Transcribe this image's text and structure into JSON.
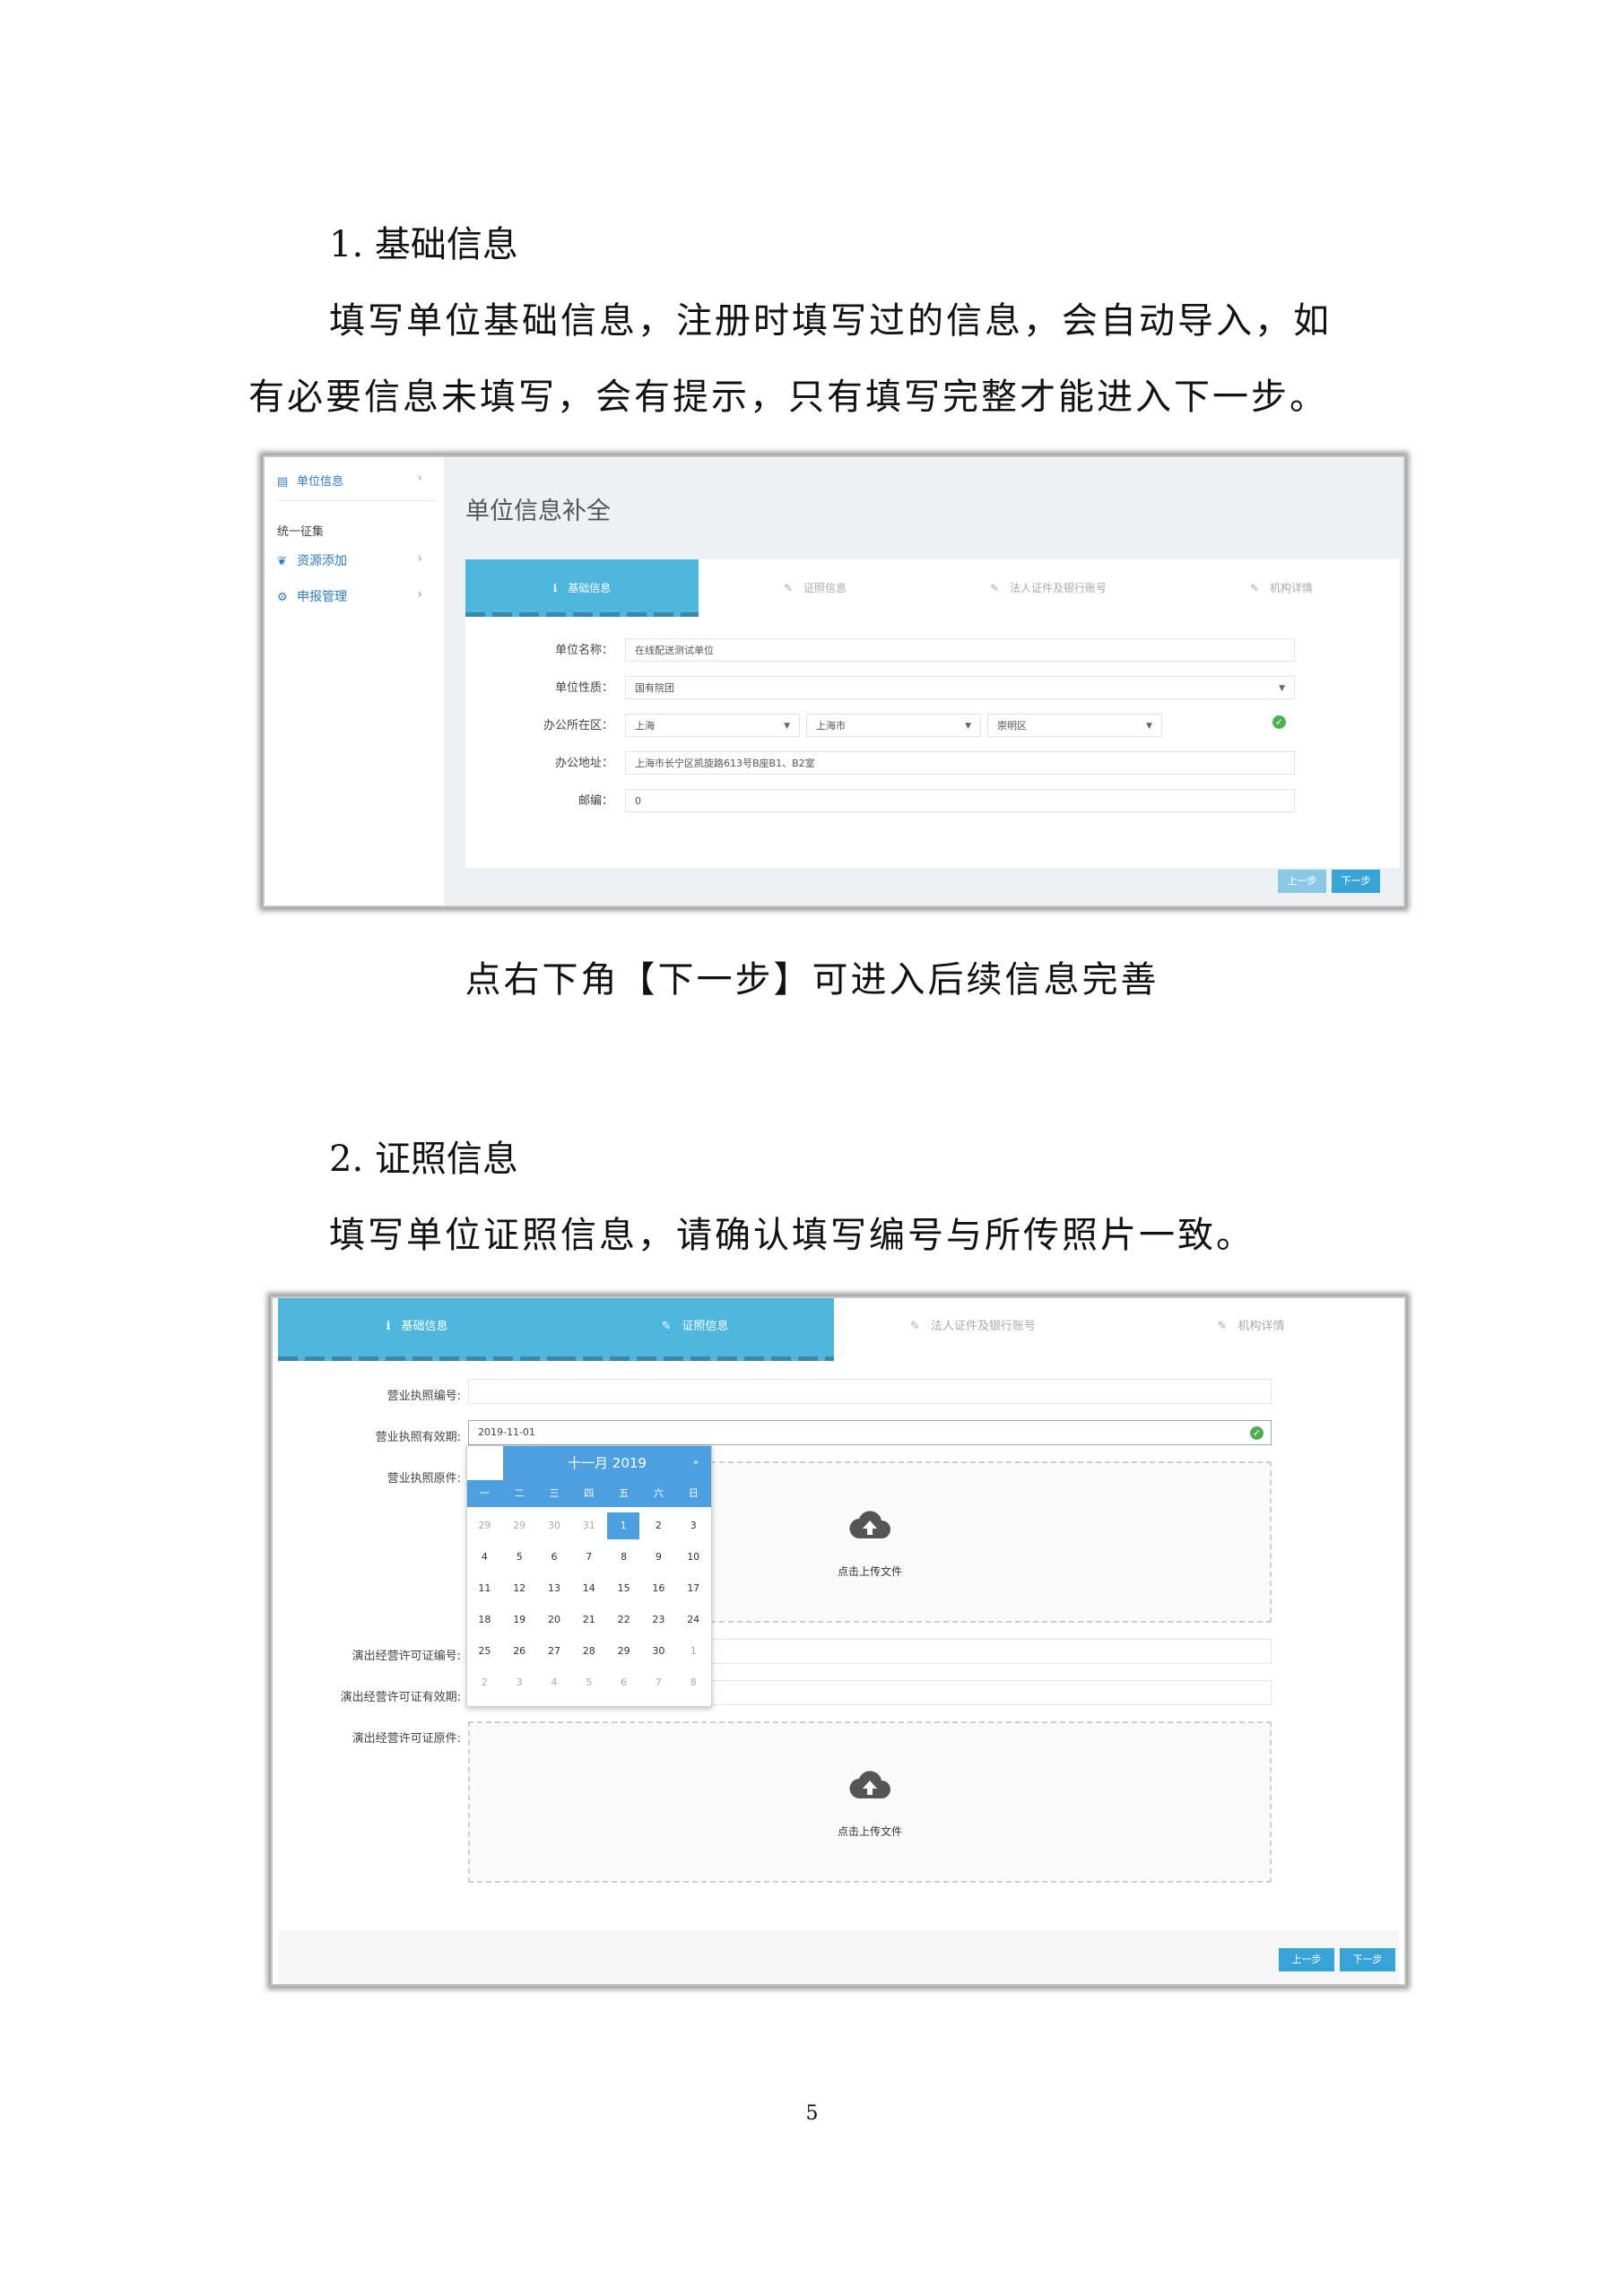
{
  "doc": {
    "section1_title": "1. 基础信息",
    "section1_para_line1": "填写单位基础信息，注册时填写过的信息，会自动导入，如",
    "section1_para_line2": "有必要信息未填写，会有提示，只有填写完整才能进入下一步。",
    "section1_caption": "点右下角【下一步】可进入后续信息完善",
    "section2_title": "2. 证照信息",
    "section2_para": "填写单位证照信息，请确认填写编号与所传照片一致。",
    "page_number": "5"
  },
  "shot1": {
    "sidebar": {
      "top_item": "单位信息",
      "group_title": "统一征集",
      "items": [
        {
          "label": "资源添加"
        },
        {
          "label": "申报管理"
        }
      ]
    },
    "page_title": "单位信息补全",
    "tabs": [
      {
        "label": "基础信息",
        "icon": "info-icon"
      },
      {
        "label": "证照信息",
        "icon": "edit-icon"
      },
      {
        "label": "法人证件及银行账号",
        "icon": "edit-icon"
      },
      {
        "label": "机构详情",
        "icon": "edit-icon"
      }
    ],
    "form": {
      "name_label": "单位名称：",
      "name_value": "在线配送测试单位",
      "type_label": "单位性质：",
      "type_value": "国有院团",
      "region_label": "办公所在区：",
      "province": "上海",
      "city": "上海市",
      "district": "崇明区",
      "address_label": "办公地址：",
      "address_value": "上海市长宁区凯旋路613号B座B1、B2室",
      "postcode_label": "邮编：",
      "postcode_value": "0"
    },
    "buttons": {
      "prev": "上一步",
      "next": "下一步"
    }
  },
  "shot2": {
    "tabs": [
      {
        "label": "基础信息",
        "icon": "info-icon"
      },
      {
        "label": "证照信息",
        "icon": "edit-icon"
      },
      {
        "label": "法人证件及银行账号",
        "icon": "edit-icon"
      },
      {
        "label": "机构详情",
        "icon": "edit-icon"
      }
    ],
    "form": {
      "license_no_label": "营业执照编号:",
      "license_expiry_label": "营业执照有效期:",
      "license_expiry_value": "2019-11-01",
      "license_file_label": "营业执照原件:",
      "perf_no_label": "演出经营许可证编号:",
      "perf_expiry_label": "演出经营许可证有效期:",
      "perf_file_label": "演出经营许可证原件:",
      "upload_text": "点击上传文件"
    },
    "calendar": {
      "title": "十一月 2019",
      "next_arrow": "»",
      "weekdays": [
        "一",
        "二",
        "三",
        "四",
        "五",
        "六",
        "日"
      ],
      "selected": "1",
      "rows": [
        [
          "29",
          "29",
          "30",
          "31",
          "1",
          "2",
          "3"
        ],
        [
          "4",
          "5",
          "6",
          "7",
          "8",
          "9",
          "10"
        ],
        [
          "11",
          "12",
          "13",
          "14",
          "15",
          "16",
          "17"
        ],
        [
          "18",
          "19",
          "20",
          "21",
          "22",
          "23",
          "24"
        ],
        [
          "25",
          "26",
          "27",
          "28",
          "29",
          "30",
          "1"
        ],
        [
          "2",
          "3",
          "4",
          "5",
          "6",
          "7",
          "8"
        ]
      ]
    },
    "buttons": {
      "prev": "上一步",
      "next": "下一步"
    }
  }
}
